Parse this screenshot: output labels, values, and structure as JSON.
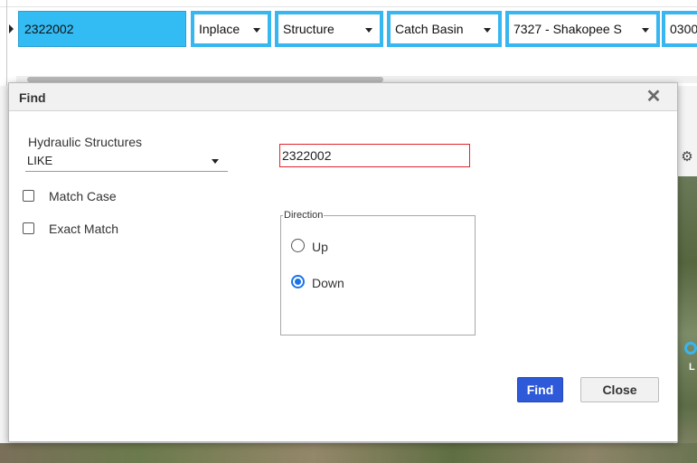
{
  "grid": {
    "selected_row": {
      "id": "2322002",
      "status": "Inplace",
      "class": "Structure",
      "type": "Catch Basin",
      "location": "7327 - Shakopee S",
      "next_value": "0300"
    }
  },
  "map": {
    "tool_icon": "tool-icon",
    "feature_label": "L"
  },
  "dialog": {
    "title": "Find",
    "close_icon": "close-icon",
    "layer_label": "Hydraulic Structures",
    "operator": "LIKE",
    "search_value": "2322002",
    "match_case_label": "Match Case",
    "exact_match_label": "Exact Match",
    "direction_legend": "Direction",
    "direction_options": [
      {
        "label": "Up",
        "selected": false
      },
      {
        "label": "Down",
        "selected": true
      }
    ],
    "find_button": "Find",
    "close_button": "Close",
    "colors": {
      "row_highlight": "#33bbf3",
      "cell_border": "#38b6f0",
      "primary_button": "#2e59d9",
      "input_error_border": "#e0242a",
      "radio_selected": "#1a73e8"
    }
  }
}
